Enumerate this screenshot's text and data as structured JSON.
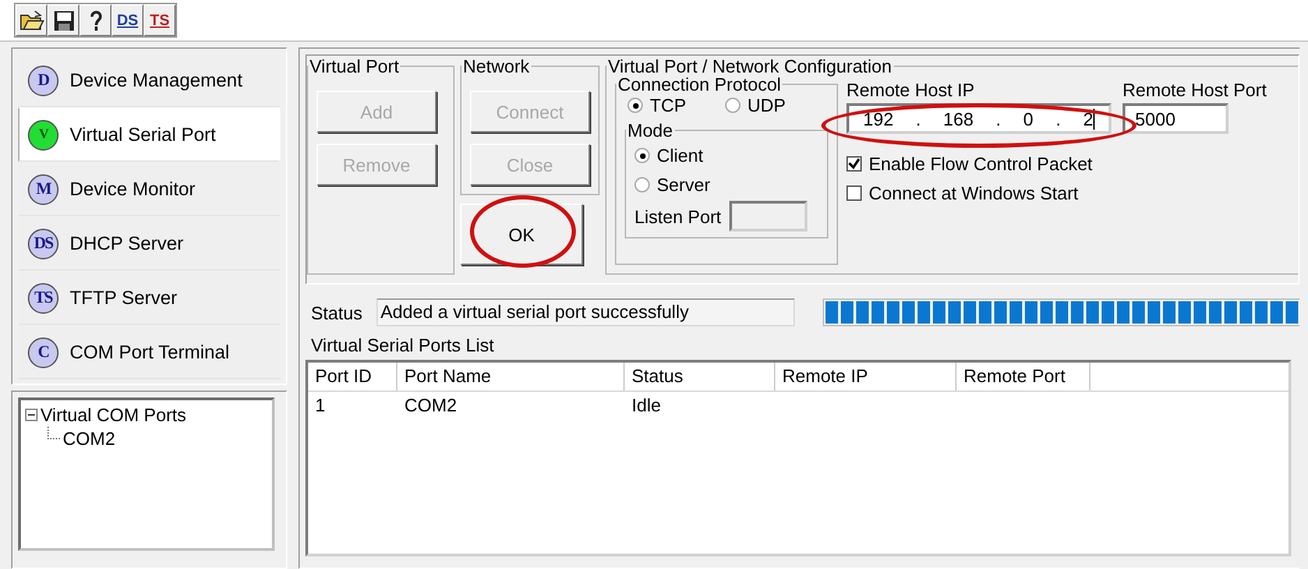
{
  "toolbar": [
    {
      "kind": "open"
    },
    {
      "kind": "save"
    },
    {
      "kind": "help"
    },
    {
      "kind": "text",
      "label": "DS",
      "color": "#1f3fa0"
    },
    {
      "kind": "text",
      "label": "TS",
      "color": "#c02020"
    }
  ],
  "sidebar": {
    "items": [
      {
        "badge": "D",
        "label": "Device Management",
        "selected": false
      },
      {
        "badge": "V",
        "label": "Virtual Serial Port",
        "selected": true
      },
      {
        "badge": "M",
        "label": "Device Monitor",
        "selected": false
      },
      {
        "badge": "DS",
        "label": "DHCP Server",
        "selected": false
      },
      {
        "badge": "TS",
        "label": "TFTP Server",
        "selected": false
      },
      {
        "badge": "C",
        "label": "COM Port Terminal",
        "selected": false
      }
    ]
  },
  "tree": [
    {
      "label": "Virtual COM Ports",
      "expanded": true,
      "children": [
        {
          "label": "COM2"
        }
      ]
    }
  ],
  "virtual_port": {
    "title": "Virtual Port",
    "buttons": [
      {
        "label": "Add",
        "disabled": true
      },
      {
        "label": "Remove",
        "disabled": true
      }
    ]
  },
  "network": {
    "title": "Network",
    "buttons": [
      {
        "label": "Connect",
        "disabled": true
      },
      {
        "label": "Close",
        "disabled": true
      }
    ]
  },
  "ok_button": {
    "label": "OK",
    "disabled": false,
    "highlighted": true
  },
  "configuration": {
    "title": "Virtual Port / Network Configuration",
    "protocol": {
      "title": "Connection Protocol",
      "options": [
        {
          "label": "TCP",
          "selected": true
        },
        {
          "label": "UDP",
          "selected": false
        }
      ]
    },
    "mode": {
      "title": "Mode",
      "options": [
        {
          "label": "Client",
          "selected": true
        },
        {
          "label": "Server",
          "selected": false
        }
      ],
      "listen_port_label": "Listen Port"
    },
    "remote_ip": {
      "label": "Remote Host IP",
      "octets": [
        "192",
        "168",
        "0",
        "2"
      ],
      "separator": ".",
      "highlighted": true
    },
    "remote_port": {
      "label": "Remote Host Port",
      "value": "5000"
    },
    "checkboxes": [
      {
        "label": "Enable Flow Control Packet",
        "checked": true
      },
      {
        "label": "Connect at Windows Start",
        "checked": false
      }
    ]
  },
  "status": {
    "label": "Status",
    "message": "Added a virtual serial port successfully",
    "progress": {
      "level": 1
    }
  },
  "ports_list": {
    "title": "Virtual Serial Ports List",
    "columns": [
      "Port ID",
      "Port Name",
      "Status",
      "Remote IP",
      "Remote Port"
    ],
    "rows": [
      [
        "1",
        "COM2",
        "Idle"
      ]
    ]
  }
}
